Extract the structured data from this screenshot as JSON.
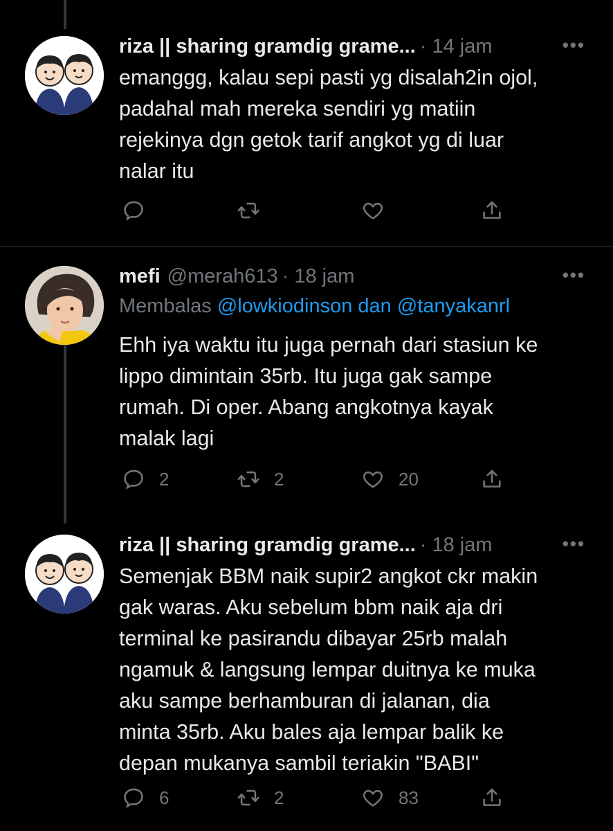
{
  "tweets": [
    {
      "name": "riza || sharing gramdig grame...",
      "handle": "",
      "time": "14 jam",
      "reply_to": null,
      "text": "emanggg, kalau sepi pasti yg disalah2in ojol,\npadahal mah mereka sendiri yg matiin\nrejekinya dgn getok tarif angkot yg di luar\nnalar itu",
      "counts": {
        "replies": "",
        "retweets": "",
        "likes": ""
      },
      "avatar_icon": "cartoon-avatar-icon"
    },
    {
      "name": "mefi",
      "handle": "@merah613",
      "time": "18 jam",
      "reply_to": {
        "prefix": "Membalas",
        "mentions": "@lowkiodinson dan @tanyakanrl"
      },
      "text": "Ehh iya waktu itu juga pernah dari stasiun ke\nlippo dimintain 35rb. Itu juga gak sampe\nrumah. Di oper. Abang angkotnya kayak\nmalak lagi",
      "counts": {
        "replies": "2",
        "retweets": "2",
        "likes": "20"
      },
      "avatar_icon": "photo-avatar-icon"
    },
    {
      "name": "riza || sharing gramdig grame...",
      "handle": "",
      "time": "18 jam",
      "reply_to": null,
      "text": "Semenjak BBM naik supir2 angkot ckr makin\ngak waras. Aku sebelum bbm naik aja dri\nterminal ke pasirandu dibayar 25rb malah\nngamuk & langsung lempar duitnya ke muka\naku sampe berhamburan di jalanan, dia\nminta 35rb. Aku bales aja lempar balik ke\ndepan mukanya sambil teriakin \"BABI\"",
      "counts": {
        "replies": "6",
        "retweets": "2",
        "likes": "83"
      },
      "avatar_icon": "cartoon-avatar-icon"
    }
  ],
  "ui": {
    "dot": "·",
    "more": "•••"
  },
  "colors": {
    "background": "#000000",
    "text": "#e7e9ea",
    "muted": "#71767b",
    "link": "#1d9bf0",
    "divider": "#2f3336"
  },
  "icons": [
    "reply-icon",
    "retweet-icon",
    "like-icon",
    "share-icon",
    "more-icon"
  ]
}
